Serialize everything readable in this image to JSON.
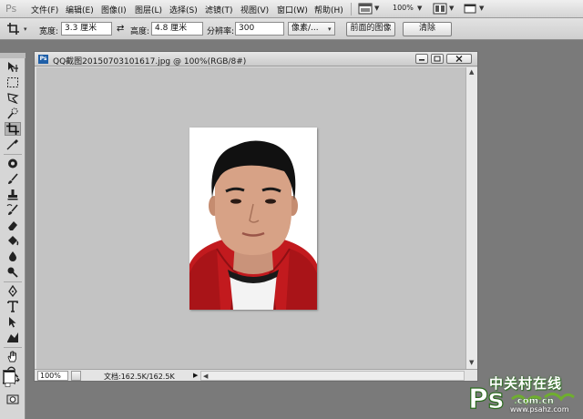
{
  "app": {
    "logo": "Ps"
  },
  "menubar": {
    "items": [
      "文件(F)",
      "编辑(E)",
      "图像(I)",
      "图层(L)",
      "选择(S)",
      "滤镜(T)",
      "视图(V)",
      "窗口(W)",
      "帮助(H)"
    ],
    "zoom": "100%"
  },
  "options": {
    "width_label": "宽度:",
    "width_value": "3.3 厘米",
    "height_label": "高度:",
    "height_value": "4.8 厘米",
    "resolution_label": "分辨率:",
    "resolution_value": "300",
    "unit_value": "像素/...",
    "front_image_button": "前面的图像",
    "clear_button": "清除"
  },
  "document": {
    "title": "QQ截图20150703101617.jpg @ 100%(RGB/8#)",
    "ps_badge": "Ps",
    "zoom": "100%",
    "status": "文档:162.5K/162.5K"
  },
  "watermark": {
    "text": "中关村在线",
    "url": "www.psahz.com"
  }
}
